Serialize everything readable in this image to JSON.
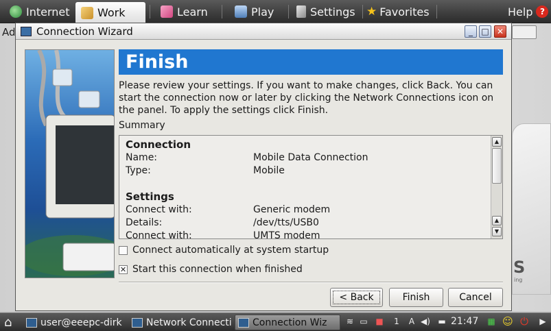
{
  "topbar": {
    "tabs": [
      {
        "label": "Internet"
      },
      {
        "label": "Work"
      },
      {
        "label": "Learn"
      },
      {
        "label": "Play"
      },
      {
        "label": "Settings"
      },
      {
        "label": "Favorites"
      }
    ],
    "help_label": "Help"
  },
  "background": {
    "address_label": "Ad",
    "brand_fragment": "S",
    "brand_subtext": "ing"
  },
  "window": {
    "title": "Connection Wizard",
    "minimize": "_",
    "maximize": "□",
    "close": "✕"
  },
  "banner": {
    "title": "Finish"
  },
  "description": "Please review your settings. If you want to make changes, click Back. You can start the connection now or later by clicking the Network Connections icon on the panel. To apply the settings click Finish.",
  "summary": {
    "label": "Summary",
    "connection_heading": "Connection",
    "name_key": "Name:",
    "name_value": "Mobile Data Connection",
    "type_key": "Type:",
    "type_value": "Mobile",
    "settings_heading": "Settings",
    "connect_with_key": "Connect with:",
    "connect_with_value": "Generic modem",
    "details_key": "Details:",
    "details_value": "/dev/tts/USB0",
    "connect_with2_key": "Connect with:",
    "connect_with2_value": "UMTS modem"
  },
  "options": {
    "auto_connect": {
      "label": "Connect automatically at system startup",
      "checked": false
    },
    "start_connection": {
      "label": "Start this connection when finished",
      "checked": true
    }
  },
  "buttons": {
    "back": "< Back",
    "finish": "Finish",
    "cancel": "Cancel"
  },
  "taskbar": {
    "tasks": [
      {
        "label": "user@eeepc-dirk"
      },
      {
        "label": "Network Connecti"
      },
      {
        "label": "Connection Wiz"
      }
    ],
    "clock": "21:47"
  },
  "colors": {
    "banner": "#2077d0",
    "topbar": "#3d3d3d",
    "close_button": "#c8321d"
  }
}
